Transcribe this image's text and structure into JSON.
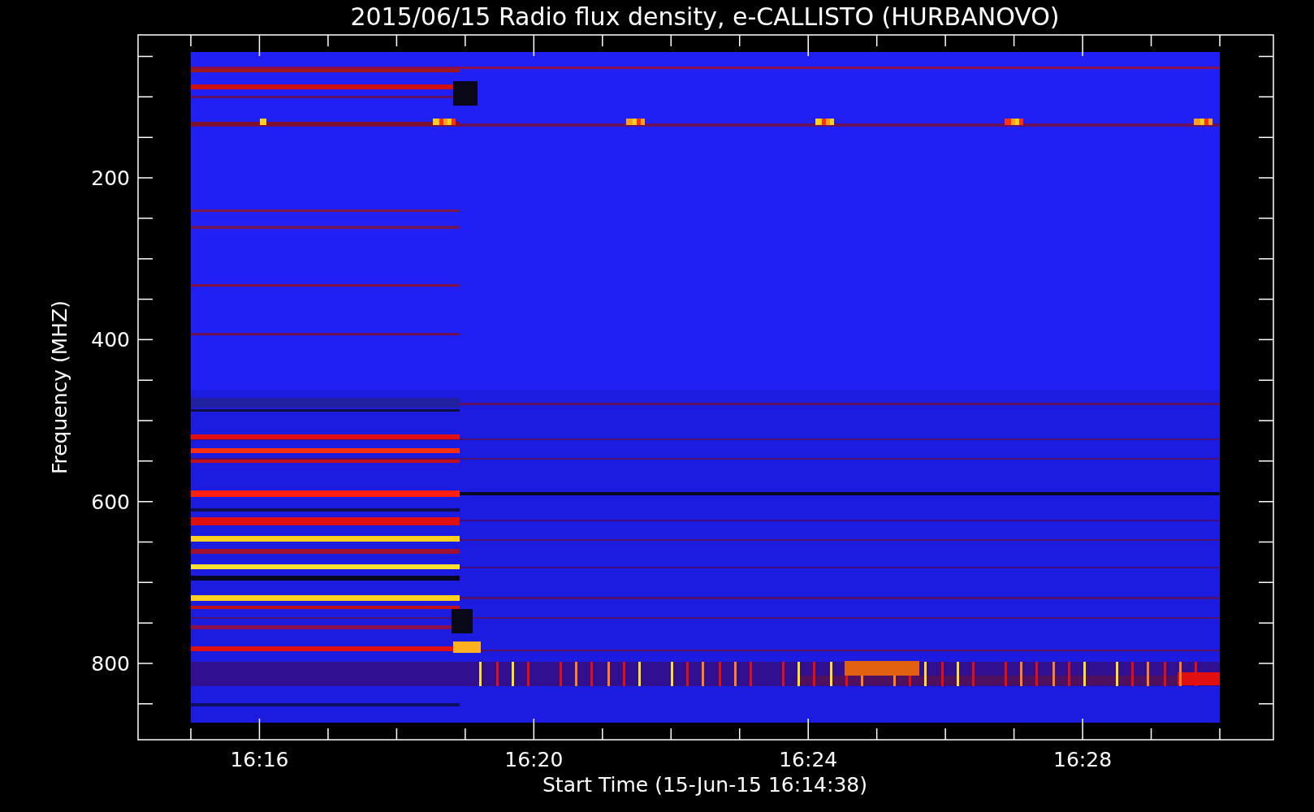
{
  "plot": {
    "title": "2015/06/15  Radio flux density, e-CALLISTO (HURBANOVO)",
    "xlabel": "Start Time (15-Jun-15 16:14:38)",
    "ylabel": "Frequency (MHZ)",
    "xticks": [
      "16:16",
      "16:20",
      "16:24",
      "16:28"
    ],
    "yticks": [
      "200",
      "400",
      "600",
      "800"
    ]
  }
}
